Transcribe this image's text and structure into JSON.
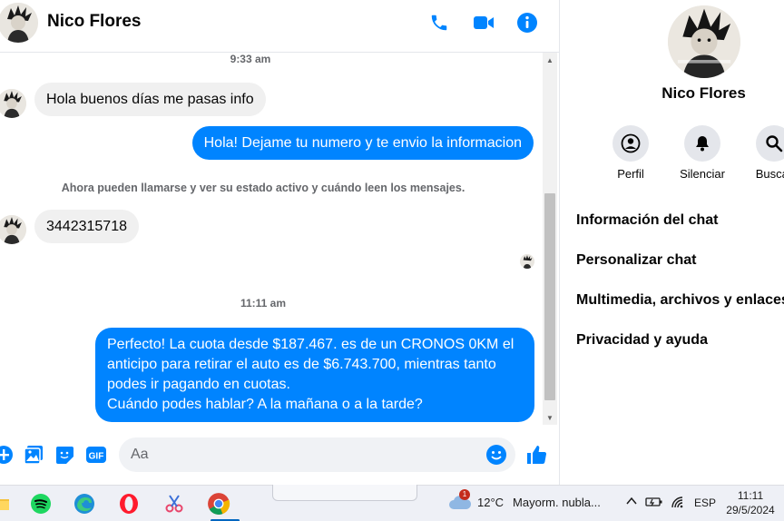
{
  "contact": {
    "name": "Nico Flores"
  },
  "header": {
    "icons": [
      "phone-icon",
      "video-camera-icon",
      "info-icon"
    ],
    "accent_color": "#0084ff"
  },
  "messages": {
    "timestamp_1": "9:33 am",
    "incoming_1": "Hola buenos días me pasas info",
    "outgoing_1": "Hola! Dejame tu numero y te envio la informacion",
    "system_notice": "Ahora pueden llamarse y ver su estado activo y cuándo leen los mensajes.",
    "incoming_2": "3442315718",
    "timestamp_2": "11:11 am",
    "outgoing_2_lines": [
      "Perfecto! La cuota desde $187.467. es de un CRONOS 0KM el",
      "anticipo para retirar el auto es de $6.743.700, mientras tanto",
      "podes ir pagando en cuotas.",
      "Cuándo podes hablar? A la mañana o a la tarde?"
    ]
  },
  "composer": {
    "placeholder": "Aa",
    "icons": [
      "plus-icon",
      "gallery-icon",
      "sticker-icon",
      "gif-icon",
      "emoji-icon",
      "thumbs-up-icon"
    ],
    "gif_label": "GIF"
  },
  "info_panel": {
    "name": "Nico Flores",
    "actions": [
      {
        "label": "Perfil",
        "icon": "profile-icon"
      },
      {
        "label": "Silenciar",
        "icon": "bell-icon"
      },
      {
        "label": "Buscar",
        "icon": "search-icon"
      }
    ],
    "menu": [
      "Información del chat",
      "Personalizar chat",
      "Multimedia, archivos y enlaces",
      "Privacidad y ayuda"
    ]
  },
  "taskbar": {
    "apps": [
      "file-explorer-icon",
      "spotify-icon",
      "edge-icon",
      "opera-icon",
      "snipping-tool-icon",
      "chrome-icon"
    ],
    "weather": {
      "temperature": "12°C",
      "description": "Mayorm. nubla...",
      "badge": "1"
    },
    "language": "ESP",
    "time": "11:11",
    "date": "29/5/2024"
  }
}
